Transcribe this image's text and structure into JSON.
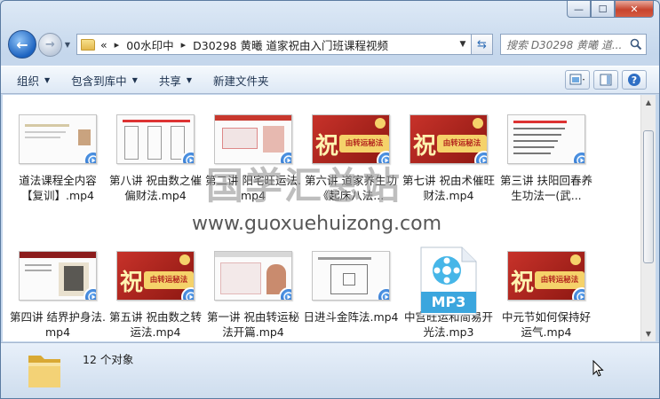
{
  "window": {
    "controls": {
      "minimize": "—",
      "maximize": "☐",
      "close": "✕"
    }
  },
  "address": {
    "chevron": "«",
    "crumbs": [
      "00水印中",
      "D30298 黄曦 道家祝由入门班课程视频"
    ],
    "separator": "▸"
  },
  "search": {
    "placeholder": "搜索 D30298 黄曦 道..."
  },
  "toolbar": {
    "organize": "组织",
    "include_in_library": "包含到库中",
    "share": "共享",
    "new_folder": "新建文件夹"
  },
  "files": [
    {
      "name": "道法课程全内容【复训】.mp4",
      "thumb": "slide-plain"
    },
    {
      "name": "第八讲 祝由数之催偏财法.mp4",
      "thumb": "talisman"
    },
    {
      "name": "第二讲 阳宅旺运法.mp4",
      "thumb": "slide-red"
    },
    {
      "name": "第六讲 道家养生功《起床八法...",
      "thumb": "red-banner"
    },
    {
      "name": "第七讲 祝由术催旺财法.mp4",
      "thumb": "red-banner"
    },
    {
      "name": "第三讲 扶阳回春养生功法一(武...",
      "thumb": "slide-list"
    },
    {
      "name": "第四讲 结界护身法.mp4",
      "thumb": "slide-calli"
    },
    {
      "name": "第五讲 祝由数之转运法.mp4",
      "thumb": "red-banner"
    },
    {
      "name": "第一讲 祝由转运秘法开篇.mp4",
      "thumb": "slide-person"
    },
    {
      "name": "日进斗金阵法.mp4",
      "thumb": "diagram"
    },
    {
      "name": "中宫旺运和简易开光法.mp3",
      "thumb": "mp3"
    },
    {
      "name": "中元节如何保持好运气.mp4",
      "thumb": "red-banner"
    }
  ],
  "banner_text": "祝",
  "banner_sub": "由转运秘法",
  "mp3_label": "MP3",
  "status": {
    "count": "12 个对象"
  },
  "watermark": {
    "cn": "国学汇总站",
    "en": "www.guoxuehuizong.com"
  },
  "colors": {
    "accent": "#1557b5",
    "banner_red": "#b3241e",
    "window_bg": "#c9d9ec"
  }
}
